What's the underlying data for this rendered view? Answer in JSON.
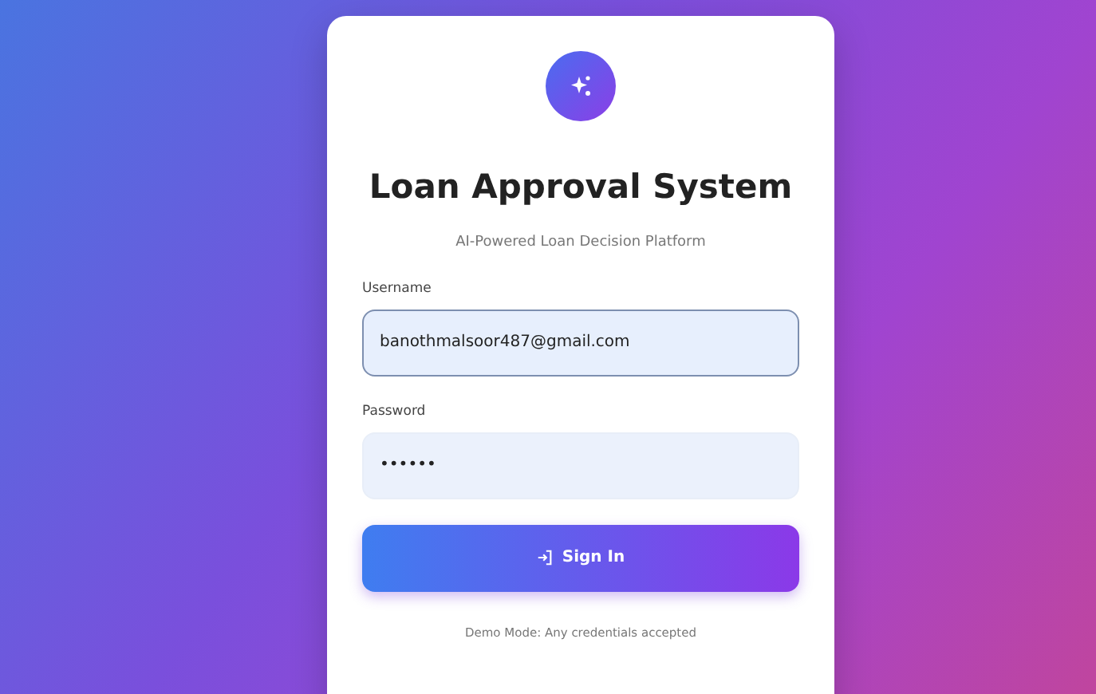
{
  "title": "Loan Approval System",
  "subtitle": "AI-Powered Loan Decision Platform",
  "fields": [
    {
      "label": "Username",
      "value": "banothmalsoor487@gmail.com",
      "focused": true
    },
    {
      "label": "Password",
      "value": "••••••",
      "focused": false
    }
  ],
  "button": {
    "label": "Sign In"
  },
  "note": "Demo Mode: Any credentials accepted"
}
